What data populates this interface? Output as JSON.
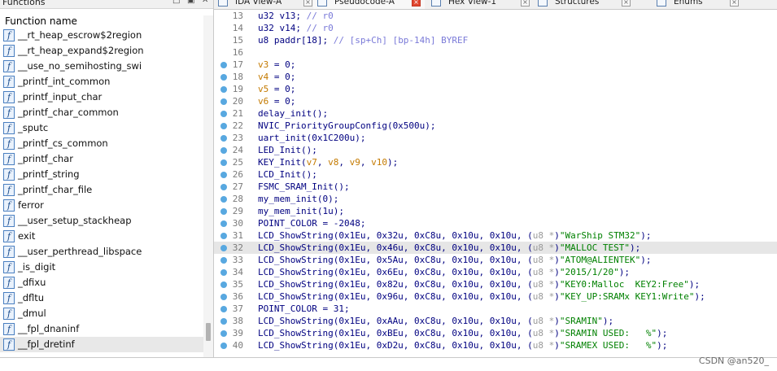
{
  "functions_pane": {
    "title": "Functions",
    "column_header": "Function name",
    "icon_glyph": "f",
    "items": [
      "__rt_heap_escrow$2region",
      "__rt_heap_expand$2region",
      "__use_no_semihosting_swi",
      "_printf_int_common",
      "_printf_input_char",
      "_printf_char_common",
      "_sputc",
      "_printf_cs_common",
      "_printf_char",
      "_printf_string",
      "_printf_char_file",
      "ferror",
      "__user_setup_stackheap",
      "exit",
      "__user_perthread_libspace",
      "_is_digit",
      "_dfixu",
      "_dfltu",
      "_dmul",
      "__fpl_dnaninf",
      "__fpl_dretinf"
    ]
  },
  "tabs": [
    {
      "label": "IDA View-A",
      "active": false
    },
    {
      "label": "Pseudocode-A",
      "active": true
    },
    {
      "label": "Hex View-1",
      "active": false
    },
    {
      "label": "Structures",
      "active": false
    },
    {
      "label": "Enums",
      "active": false
    }
  ],
  "code": {
    "highlighted_line": 32,
    "lines": [
      {
        "n": "13",
        "dot": false,
        "parts": [
          [
            "k",
            "u32 v13; "
          ],
          [
            "c",
            "// r0"
          ]
        ]
      },
      {
        "n": "14",
        "dot": false,
        "parts": [
          [
            "k",
            "u32 v14; "
          ],
          [
            "c",
            "// r0"
          ]
        ]
      },
      {
        "n": "15",
        "dot": false,
        "parts": [
          [
            "k",
            "u8 paddr[18]; "
          ],
          [
            "c",
            "// [sp+Ch] [bp-14h] BYREF"
          ]
        ]
      },
      {
        "n": "16",
        "dot": false,
        "parts": []
      },
      {
        "n": "17",
        "dot": true,
        "parts": [
          [
            "v",
            "v3"
          ],
          [
            "k",
            " = 0;"
          ]
        ]
      },
      {
        "n": "18",
        "dot": true,
        "parts": [
          [
            "v",
            "v4"
          ],
          [
            "k",
            " = 0;"
          ]
        ]
      },
      {
        "n": "19",
        "dot": true,
        "parts": [
          [
            "v",
            "v5"
          ],
          [
            "k",
            " = 0;"
          ]
        ]
      },
      {
        "n": "20",
        "dot": true,
        "parts": [
          [
            "v",
            "v6"
          ],
          [
            "k",
            " = 0;"
          ]
        ]
      },
      {
        "n": "21",
        "dot": true,
        "parts": [
          [
            "k",
            "delay_init();"
          ]
        ]
      },
      {
        "n": "22",
        "dot": true,
        "parts": [
          [
            "k",
            "NVIC_PriorityGroupConfig(0x500u);"
          ]
        ]
      },
      {
        "n": "23",
        "dot": true,
        "parts": [
          [
            "k",
            "uart_init(0x1C200u);"
          ]
        ]
      },
      {
        "n": "24",
        "dot": true,
        "parts": [
          [
            "k",
            "LED_Init();"
          ]
        ]
      },
      {
        "n": "25",
        "dot": true,
        "parts": [
          [
            "k",
            "KEY_Init("
          ],
          [
            "v",
            "v7"
          ],
          [
            "k",
            ", "
          ],
          [
            "v",
            "v8"
          ],
          [
            "k",
            ", "
          ],
          [
            "v",
            "v9"
          ],
          [
            "k",
            ", "
          ],
          [
            "v",
            "v10"
          ],
          [
            "k",
            ");"
          ]
        ]
      },
      {
        "n": "26",
        "dot": true,
        "parts": [
          [
            "k",
            "LCD_Init();"
          ]
        ]
      },
      {
        "n": "27",
        "dot": true,
        "parts": [
          [
            "k",
            "FSMC_SRAM_Init();"
          ]
        ]
      },
      {
        "n": "28",
        "dot": true,
        "parts": [
          [
            "k",
            "my_mem_init(0);"
          ]
        ]
      },
      {
        "n": "29",
        "dot": true,
        "parts": [
          [
            "k",
            "my_mem_init(1u);"
          ]
        ]
      },
      {
        "n": "30",
        "dot": true,
        "parts": [
          [
            "k",
            "POINT_COLOR = -2048;"
          ]
        ]
      },
      {
        "n": "31",
        "dot": true,
        "parts": [
          [
            "k",
            "LCD_ShowString(0x1Eu, 0x32u, 0xC8u, 0x10u, 0x10u, ("
          ],
          [
            "t",
            "u8 *"
          ],
          [
            "k",
            ")"
          ],
          [
            "s",
            "\"WarShip STM32\""
          ],
          [
            "k",
            ");"
          ]
        ]
      },
      {
        "n": "32",
        "dot": true,
        "parts": [
          [
            "k",
            "LCD_ShowString(0x1Eu, 0x46u, 0xC8u, 0x10u, 0x10u, ("
          ],
          [
            "t",
            "u8 *"
          ],
          [
            "k",
            ")"
          ],
          [
            "s",
            "\"MALLOC TEST\""
          ],
          [
            "k",
            ");"
          ]
        ]
      },
      {
        "n": "33",
        "dot": true,
        "parts": [
          [
            "k",
            "LCD_ShowString(0x1Eu, 0x5Au, 0xC8u, 0x10u, 0x10u, ("
          ],
          [
            "t",
            "u8 *"
          ],
          [
            "k",
            ")"
          ],
          [
            "s",
            "\"ATOM@ALIENTEK\""
          ],
          [
            "k",
            ");"
          ]
        ]
      },
      {
        "n": "34",
        "dot": true,
        "parts": [
          [
            "k",
            "LCD_ShowString(0x1Eu, 0x6Eu, 0xC8u, 0x10u, 0x10u, ("
          ],
          [
            "t",
            "u8 *"
          ],
          [
            "k",
            ")"
          ],
          [
            "s",
            "\"2015/1/20\""
          ],
          [
            "k",
            ");"
          ]
        ]
      },
      {
        "n": "35",
        "dot": true,
        "parts": [
          [
            "k",
            "LCD_ShowString(0x1Eu, 0x82u, 0xC8u, 0x10u, 0x10u, ("
          ],
          [
            "t",
            "u8 *"
          ],
          [
            "k",
            ")"
          ],
          [
            "s",
            "\"KEY0:Malloc  KEY2:Free\""
          ],
          [
            "k",
            ");"
          ]
        ]
      },
      {
        "n": "36",
        "dot": true,
        "parts": [
          [
            "k",
            "LCD_ShowString(0x1Eu, 0x96u, 0xC8u, 0x10u, 0x10u, ("
          ],
          [
            "t",
            "u8 *"
          ],
          [
            "k",
            ")"
          ],
          [
            "s",
            "\"KEY_UP:SRAMx KEY1:Write\""
          ],
          [
            "k",
            ");"
          ]
        ]
      },
      {
        "n": "37",
        "dot": true,
        "parts": [
          [
            "k",
            "POINT_COLOR = 31;"
          ]
        ]
      },
      {
        "n": "38",
        "dot": true,
        "parts": [
          [
            "k",
            "LCD_ShowString(0x1Eu, 0xAAu, 0xC8u, 0x10u, 0x10u, ("
          ],
          [
            "t",
            "u8 *"
          ],
          [
            "k",
            ")"
          ],
          [
            "s",
            "\"SRAMIN\""
          ],
          [
            "k",
            ");"
          ]
        ]
      },
      {
        "n": "39",
        "dot": true,
        "parts": [
          [
            "k",
            "LCD_ShowString(0x1Eu, 0xBEu, 0xC8u, 0x10u, 0x10u, ("
          ],
          [
            "t",
            "u8 *"
          ],
          [
            "k",
            ")"
          ],
          [
            "s",
            "\"SRAMIN USED:   %\""
          ],
          [
            "k",
            ");"
          ]
        ]
      },
      {
        "n": "40",
        "dot": true,
        "parts": [
          [
            "k",
            "LCD_ShowString(0x1Eu, 0xD2u, 0xC8u, 0x10u, 0x10u, ("
          ],
          [
            "t",
            "u8 *"
          ],
          [
            "k",
            ")"
          ],
          [
            "s",
            "\"SRAMEX USED:   %\""
          ],
          [
            "k",
            ");"
          ]
        ]
      }
    ]
  },
  "watermark": "CSDN @an520_",
  "colors": {
    "code_text": "#000080",
    "comment": "#7a7ad8",
    "variable": "#c47a00",
    "string": "#008000",
    "type_cast": "#9a9a9a",
    "breakpoint_dot": "#58a8e0",
    "active_tab_close": "#e0462f"
  }
}
